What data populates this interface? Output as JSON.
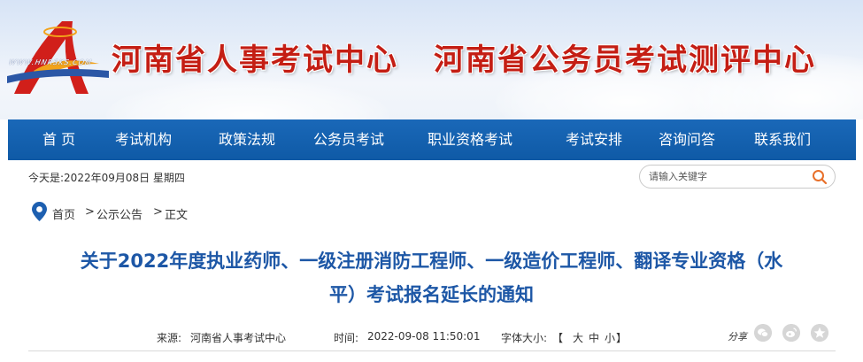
{
  "banner": {
    "logo_url_text": "WWW.HNRSKS.COM",
    "title_left": "河南省人事考试中心",
    "title_right": "河南省公务员考试测评中心"
  },
  "nav": {
    "items": [
      {
        "label": "首 页"
      },
      {
        "label": "考试机构"
      },
      {
        "label": "政策法规"
      },
      {
        "label": "公务员考试"
      },
      {
        "label": "职业资格考试"
      },
      {
        "label": "考试安排"
      },
      {
        "label": "咨询问答"
      },
      {
        "label": "联系我们"
      }
    ]
  },
  "info": {
    "date_text": "今天是:2022年09月08日 星期四"
  },
  "search": {
    "placeholder": "请输入关键字"
  },
  "breadcrumb": {
    "home": "首页",
    "sep1": ">",
    "section": "公示公告",
    "sep2": ">",
    "current": "正文"
  },
  "article": {
    "title_line1": "关于2022年度执业药师、一级注册消防工程师、一级造价工程师、翻译专业资格（水",
    "title_line2": "平）考试报名延长的通知"
  },
  "meta": {
    "source_label": "来源:",
    "source_value": "河南省人事考试中心",
    "time_label": "时间:",
    "time_value": "2022-09-08 11:50:01",
    "fontsize_label": "字体大小:",
    "fontsize_open": "【",
    "fontsize_large": "大",
    "fontsize_medium": "中",
    "fontsize_small": "小",
    "fontsize_close": "】",
    "share_label": "分享"
  },
  "colors": {
    "nav_bg": "#0f5aa6",
    "title_red": "#c41e14",
    "article_blue": "#1d57a6",
    "search_icon": "#e8702a"
  },
  "icons": [
    "logo-a-icon",
    "search-icon",
    "location-pin-icon",
    "wechat-icon",
    "weibo-icon",
    "qzone-icon"
  ]
}
